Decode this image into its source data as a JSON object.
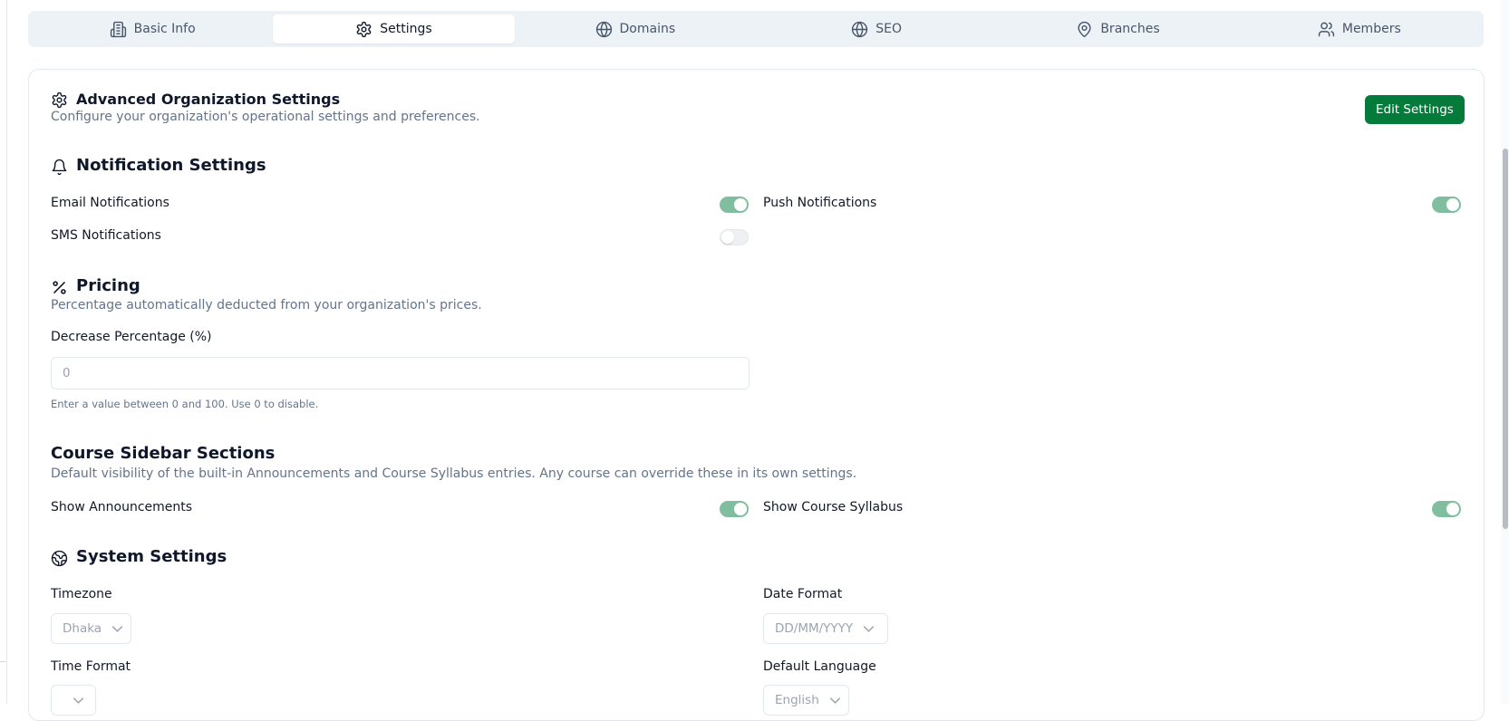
{
  "tabs": [
    {
      "label": "Basic Info",
      "icon": "building-icon",
      "active": false
    },
    {
      "label": "Settings",
      "icon": "gear-icon",
      "active": true
    },
    {
      "label": "Domains",
      "icon": "globe-icon",
      "active": false
    },
    {
      "label": "SEO",
      "icon": "globe-icon",
      "active": false
    },
    {
      "label": "Branches",
      "icon": "map-pin-icon",
      "active": false
    },
    {
      "label": "Members",
      "icon": "users-icon",
      "active": false
    }
  ],
  "header": {
    "title": "Advanced Organization Settings",
    "description": "Configure your organization's operational settings and preferences.",
    "edit_button": "Edit Settings"
  },
  "notifications": {
    "title": "Notification Settings",
    "email": {
      "label": "Email Notifications",
      "enabled": true
    },
    "push": {
      "label": "Push Notifications",
      "enabled": true
    },
    "sms": {
      "label": "SMS Notifications",
      "enabled": false
    }
  },
  "pricing": {
    "title": "Pricing",
    "description": "Percentage automatically deducted from your organization's prices.",
    "field_label": "Decrease Percentage (%)",
    "value": "0",
    "help": "Enter a value between 0 and 100. Use 0 to disable."
  },
  "course_sidebar": {
    "title": "Course Sidebar Sections",
    "description": "Default visibility of the built-in Announcements and Course Syllabus entries. Any course can override these in its own settings.",
    "announcements": {
      "label": "Show Announcements",
      "enabled": true
    },
    "syllabus": {
      "label": "Show Course Syllabus",
      "enabled": true
    }
  },
  "system": {
    "title": "System Settings",
    "timezone": {
      "label": "Timezone",
      "value": "Dhaka"
    },
    "date_format": {
      "label": "Date Format",
      "value": "DD/MM/YYYY"
    },
    "time_format": {
      "label": "Time Format",
      "value": ""
    },
    "language": {
      "label": "Default Language",
      "value": "English"
    }
  },
  "colors": {
    "accent": "#047a3b",
    "toggle_on": "#7fbf9f",
    "tab_bar": "#edf2f7"
  }
}
